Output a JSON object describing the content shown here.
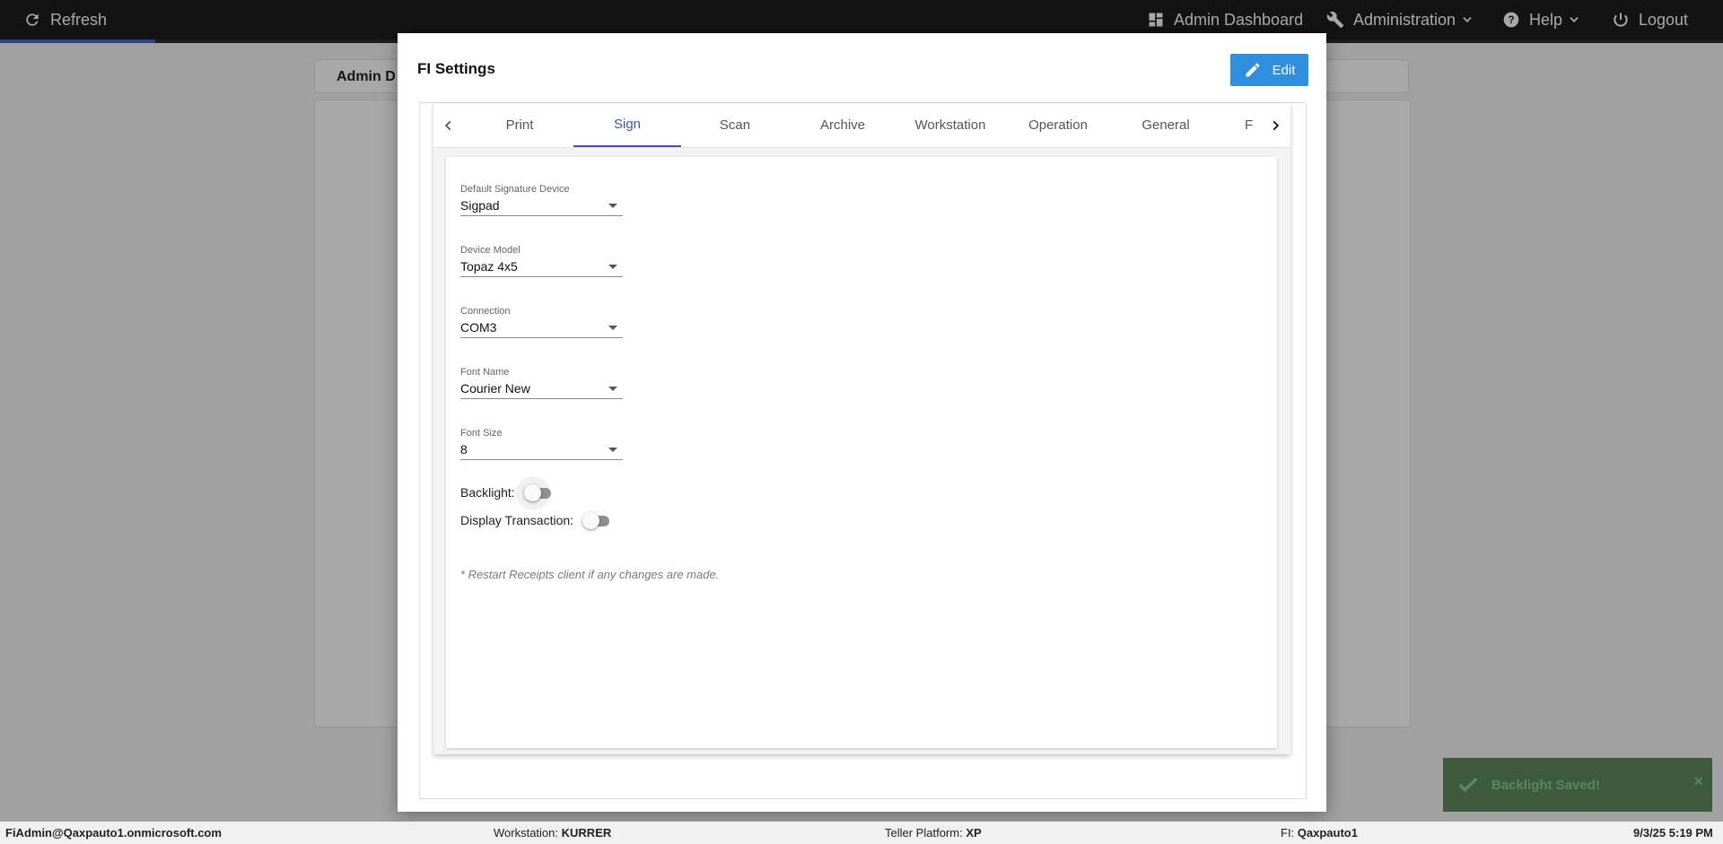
{
  "topbar": {
    "refresh_label": "Refresh",
    "admin_dashboard_label": "Admin Dashboard",
    "administration_label": "Administration",
    "help_label": "Help",
    "logout_label": "Logout",
    "progress_fraction": 0.09
  },
  "background": {
    "card_title": "Admin D"
  },
  "modal": {
    "title": "FI Settings",
    "edit_label": "Edit",
    "tabs": [
      "Print",
      "Sign",
      "Scan",
      "Archive",
      "Workstation",
      "Operation",
      "General",
      "F"
    ],
    "active_tab": "Sign",
    "fields": [
      {
        "label": "Default Signature Device",
        "value": "Sigpad"
      },
      {
        "label": "Device Model",
        "value": "Topaz 4x5"
      },
      {
        "label": "Connection",
        "value": "COM3"
      },
      {
        "label": "Font Name",
        "value": "Courier New"
      },
      {
        "label": "Font Size",
        "value": "8"
      }
    ],
    "toggles": [
      {
        "label": "Backlight:",
        "on": false
      },
      {
        "label": "Display Transaction:",
        "on": false
      }
    ],
    "note": "* Restart Receipts client if any changes are made."
  },
  "toast": {
    "message": "Backlight Saved!",
    "close": "×",
    "icon": "check-icon"
  },
  "statusbar": {
    "user": "FiAdmin@Qaxpauto1.onmicrosoft.com",
    "workstation_label": "Workstation:",
    "workstation_value": "KURRER",
    "platform_label": "Teller Platform:",
    "platform_value": "XP",
    "fi_label": "FI:",
    "fi_value": "Qaxpauto1",
    "datetime": "9/3/25 5:19 PM"
  },
  "colors": {
    "accent": "#3f51b5",
    "edit_button": "#2f8fdd",
    "topbar": "#1d1d1d",
    "toast_bg": "#3e5a3e"
  }
}
